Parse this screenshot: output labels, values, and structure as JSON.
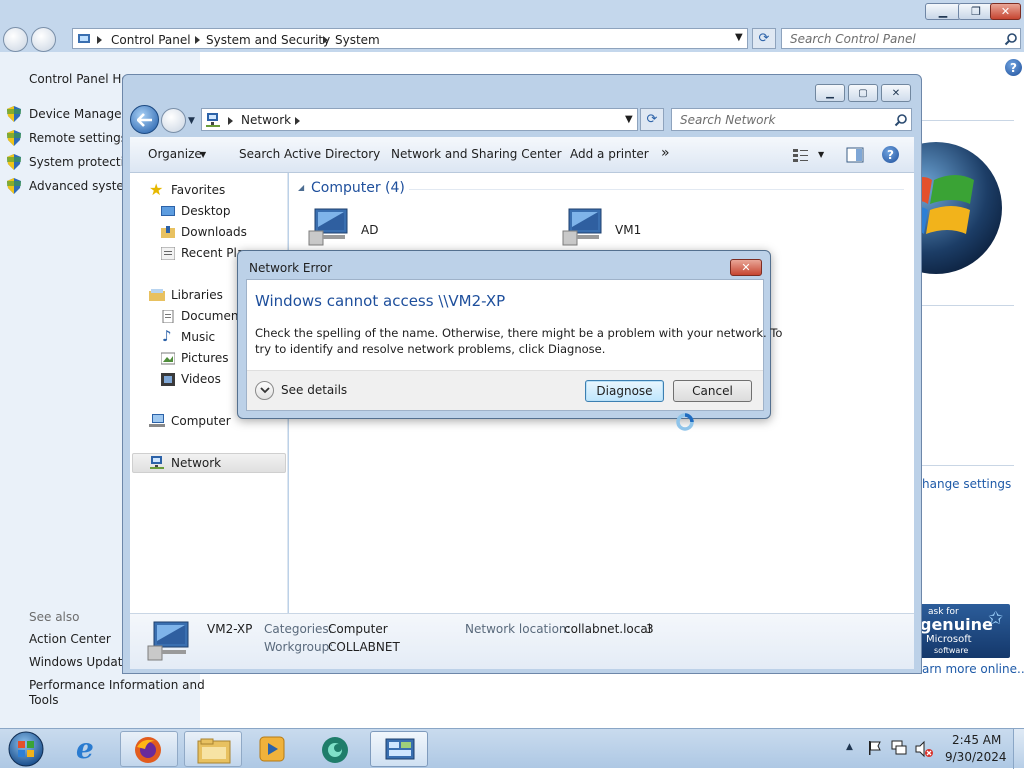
{
  "control_panel": {
    "breadcrumb": [
      "Control Panel",
      "System and Security",
      "System"
    ],
    "search_placeholder": "Search Control Panel",
    "left_links": {
      "home": "Control Panel Hom",
      "device_manager": "Device Manager",
      "remote_settings": "Remote settings",
      "system_protection": "System protection",
      "advanced": "Advanced system"
    },
    "see_also": {
      "heading": "See also",
      "action_center": "Action Center",
      "windows_update": "Windows Update",
      "perf_line1": "Performance Information and",
      "perf_line2": "Tools"
    },
    "change_settings": "hange settings",
    "genuine": {
      "ask": "ask for",
      "genuine": "genuine",
      "microsoft": "Microsoft",
      "software": "software"
    },
    "learn_more": "arn more online..."
  },
  "network_window": {
    "breadcrumb": "Network",
    "search_placeholder": "Search Network",
    "toolbar": {
      "organize": "Organize",
      "search_ad": "Search Active Directory",
      "sharing_center": "Network and Sharing Center",
      "add_printer": "Add a printer",
      "more": "»"
    },
    "nav": {
      "favorites": "Favorites",
      "desktop": "Desktop",
      "downloads": "Downloads",
      "recent": "Recent Pla",
      "libraries": "Libraries",
      "documents": "Document",
      "music": "Music",
      "pictures": "Pictures",
      "videos": "Videos",
      "computer": "Computer",
      "network": "Network"
    },
    "group_header": "Computer (4)",
    "items": {
      "ad": "AD",
      "vm1": "VM1"
    },
    "details": {
      "name": "VM2-XP",
      "categories_label": "Categories:",
      "categories_value": "Computer",
      "workgroup_label": "Workgroup:",
      "workgroup_value": "COLLABNET",
      "location_label": "Network location:",
      "location_value": "collabnet.local",
      "location_suffix": "3"
    }
  },
  "dialog": {
    "title": "Network Error",
    "heading": "Windows cannot access \\\\VM2-XP",
    "message_line1": "Check the spelling of the name. Otherwise, there might be a problem with your network. To",
    "message_line2": "try to identify and resolve network problems, click Diagnose.",
    "see_details": "See details",
    "diagnose": "Diagnose",
    "cancel": "Cancel"
  },
  "taskbar": {
    "time": "2:45 AM",
    "date": "9/30/2024"
  },
  "colors": {
    "link_blue": "#1e5aa8",
    "heading_blue": "#1e4f9c",
    "close_red": "#c64531"
  }
}
